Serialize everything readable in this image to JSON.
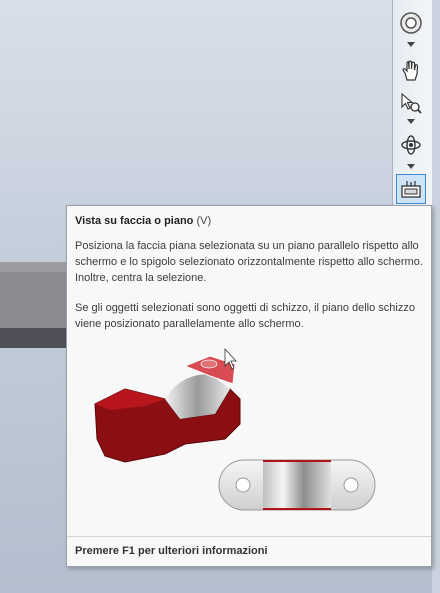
{
  "tooltip": {
    "title": "Vista su faccia o piano",
    "shortcut": "(V)",
    "description": "Posiziona la faccia piana selezionata su un piano parallelo rispetto allo schermo e lo spigolo selezionato orizzontalmente rispetto allo schermo. Inoltre, centra la selezione.",
    "note": "Se gli oggetti selezionati sono oggetti di schizzo, il piano dello schizzo viene posizionato parallelamente allo schermo.",
    "footer": "Premere F1 per ulteriori informazioni"
  },
  "navbar": {
    "buttons": [
      {
        "icon": "steering-wheel-icon"
      },
      {
        "icon": "pan-hand-icon"
      },
      {
        "icon": "zoom-cursor-icon"
      },
      {
        "icon": "orbit-icon"
      },
      {
        "icon": "look-at-icon",
        "active": true
      }
    ]
  },
  "colors": {
    "tooltip_bg": "#f8f8f8",
    "active_button_border": "#3f8ad6",
    "part_red": "#8b0e12"
  }
}
